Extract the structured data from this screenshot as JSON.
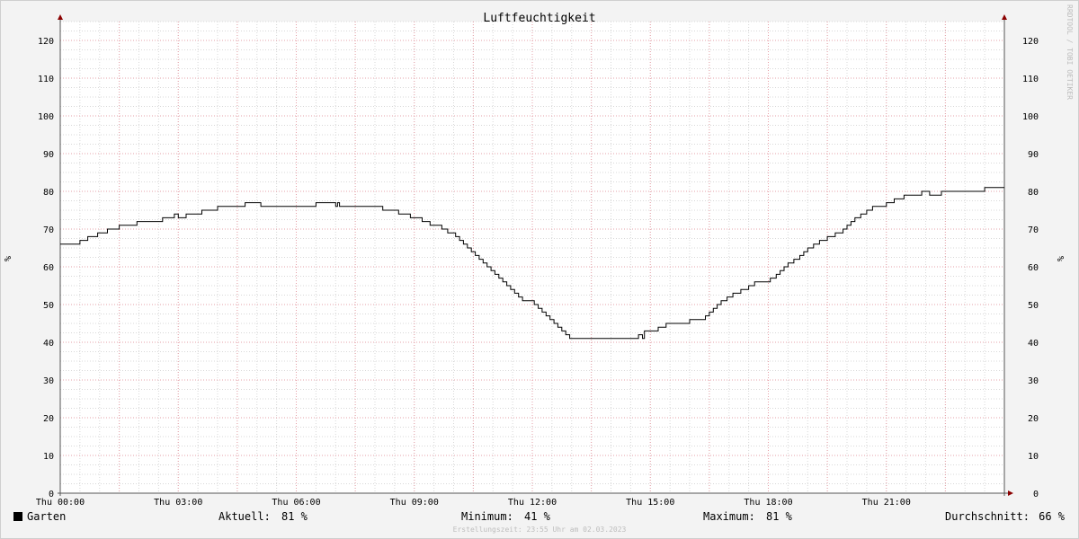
{
  "chart_data": {
    "type": "line",
    "title": "Luftfeuchtigkeit",
    "ylabel": "%",
    "ylim": [
      0,
      125
    ],
    "yticks": [
      0,
      10,
      20,
      30,
      40,
      50,
      60,
      70,
      80,
      90,
      100,
      110,
      120
    ],
    "xlim": [
      0,
      24
    ],
    "xticks": [
      {
        "hour": 0,
        "label": "Thu 00:00"
      },
      {
        "hour": 3,
        "label": "Thu 03:00"
      },
      {
        "hour": 6,
        "label": "Thu 06:00"
      },
      {
        "hour": 9,
        "label": "Thu 09:00"
      },
      {
        "hour": 12,
        "label": "Thu 12:00"
      },
      {
        "hour": 15,
        "label": "Thu 15:00"
      },
      {
        "hour": 18,
        "label": "Thu 18:00"
      },
      {
        "hour": 21,
        "label": "Thu 21:00"
      }
    ],
    "grid": true,
    "series": [
      {
        "name": "Garten",
        "color": "#000000",
        "step": true,
        "x": [
          0,
          0.5,
          0.7,
          0.95,
          1.2,
          1.5,
          1.65,
          1.95,
          2.3,
          2.6,
          2.9,
          3.0,
          3.2,
          3.4,
          3.6,
          4.0,
          4.3,
          4.7,
          5.0,
          5.1,
          5.5,
          6.0,
          6.2,
          6.5,
          7.0,
          7.05,
          7.1,
          8.0,
          8.2,
          8.3,
          8.6,
          8.9,
          9.0,
          9.2,
          9.4,
          9.7,
          9.85,
          10.05,
          10.15,
          10.25,
          10.35,
          10.45,
          10.55,
          10.65,
          10.75,
          10.85,
          10.95,
          11.05,
          11.15,
          11.25,
          11.35,
          11.45,
          11.55,
          11.65,
          11.75,
          11.85,
          11.95,
          12.05,
          12.15,
          12.25,
          12.35,
          12.45,
          12.55,
          12.65,
          12.75,
          12.85,
          12.95,
          13.05,
          13.15,
          13.25,
          13.35,
          13.45,
          13.55,
          13.65,
          13.8,
          14.5,
          14.7,
          14.8,
          14.85,
          15.0,
          15.2,
          15.4,
          15.8,
          16.0,
          16.3,
          16.4,
          16.5,
          16.6,
          16.7,
          16.8,
          16.95,
          17.1,
          17.3,
          17.5,
          17.65,
          17.9,
          18.05,
          18.2,
          18.3,
          18.4,
          18.5,
          18.65,
          18.8,
          18.9,
          19.0,
          19.15,
          19.3,
          19.5,
          19.7,
          19.9,
          20.0,
          20.1,
          20.2,
          20.35,
          20.5,
          20.65,
          20.8,
          21.0,
          21.2,
          21.45,
          21.7,
          21.9,
          22.1,
          22.3,
          22.4,
          22.45,
          22.75,
          23.5,
          23.6,
          24.0
        ],
        "y": [
          66,
          67,
          68,
          69,
          70,
          71,
          71,
          72,
          72,
          73,
          74,
          73,
          74,
          74,
          75,
          76,
          76,
          77,
          77,
          76,
          76,
          76,
          76,
          77,
          76,
          77,
          76,
          76,
          75,
          75,
          74,
          73,
          73,
          72,
          71,
          70,
          69,
          68,
          67,
          66,
          65,
          64,
          63,
          62,
          61,
          60,
          59,
          58,
          57,
          56,
          55,
          54,
          53,
          52,
          51,
          51,
          51,
          50,
          49,
          48,
          47,
          46,
          45,
          44,
          43,
          42,
          41,
          41,
          41,
          41,
          41,
          41,
          41,
          41,
          41,
          41,
          42,
          41,
          43,
          43,
          44,
          45,
          45,
          46,
          46,
          47,
          48,
          49,
          50,
          51,
          52,
          53,
          54,
          55,
          56,
          56,
          57,
          58,
          59,
          60,
          61,
          62,
          63,
          64,
          65,
          66,
          67,
          68,
          69,
          70,
          71,
          72,
          73,
          74,
          75,
          76,
          76,
          77,
          78,
          79,
          79,
          80,
          79,
          79,
          80,
          80,
          80,
          81,
          81,
          81
        ]
      }
    ]
  },
  "legend": {
    "series_name": "Garten",
    "series_color": "#000000",
    "aktuell_label": "Aktuell:",
    "aktuell_value": "81 %",
    "minimum_label": "Minimum:",
    "minimum_value": "41 %",
    "maximum_label": "Maximum:",
    "maximum_value": "81 %",
    "durchschnitt_label": "Durchschnitt:",
    "durchschnitt_value": "66 %"
  },
  "footer": {
    "created": "Erstellungszeit: 23:55 Uhr am 02.03.2023"
  },
  "watermark": "RRDTOOL / TOBI OETIKER",
  "colors": {
    "background": "#f3f3f3",
    "plot_background": "#ffffff",
    "minor_grid": "#d8d8d8",
    "major_grid": "#e6a0a8",
    "axis": "#555555",
    "arrow": "#8b0000"
  }
}
